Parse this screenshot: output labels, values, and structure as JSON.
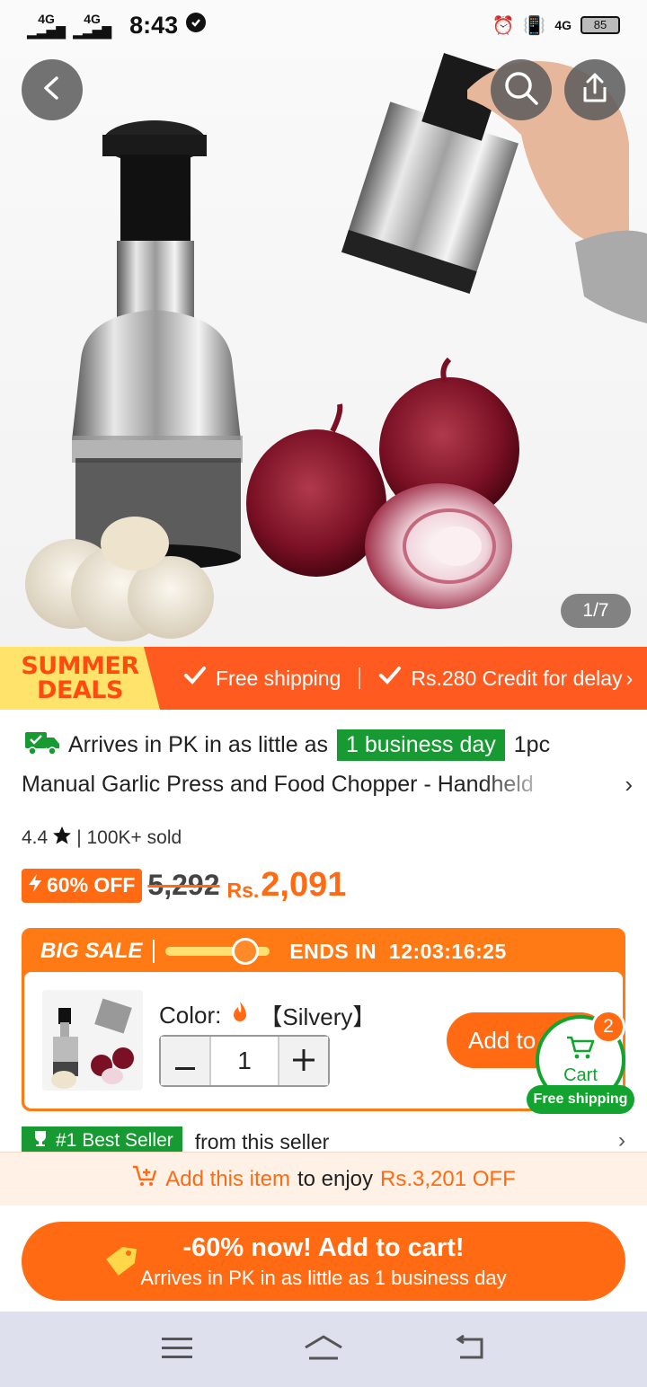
{
  "status_bar": {
    "net1": "4G",
    "net2": "4G",
    "time": "8:43",
    "net3": "4G",
    "battery": "85"
  },
  "hero": {
    "image_counter": "1/7",
    "back_icon": "chevron-left-icon",
    "search_icon": "search-icon",
    "share_icon": "share-icon"
  },
  "deals_banner": {
    "line1": "SUMMER",
    "line2": "DEALS",
    "item1": "Free shipping",
    "item2": "Rs.280 Credit for delay",
    "colors": {
      "banner": "#ff5a1f",
      "badge": "#ffe36b"
    }
  },
  "product": {
    "arrival_prefix": "Arrives in PK in as little as",
    "arrival_highlight": "1 business day",
    "arrival_suffix": "1pc",
    "title": "Manual Garlic Press and Food Chopper - Handheld",
    "rating": "4.4",
    "sold": "| 100K+ sold",
    "discount": "60% OFF",
    "old_price": "5,292",
    "currency": "Rs.",
    "new_price": "2,091"
  },
  "sale": {
    "label": "BIG SALE",
    "ends_label": "ENDS IN",
    "countdown": "12:03:16:25",
    "progress_fraction": 0.8,
    "color_label": "Color:",
    "color_value": "【Silvery】",
    "quantity": "1",
    "add_button": "Add to"
  },
  "cart": {
    "label": "Cart",
    "count": "2",
    "free_shipping": "Free shipping"
  },
  "best_seller": {
    "badge": "#1 Best Seller",
    "text": "from this seller"
  },
  "promo": {
    "highlight": "Add this item",
    "middle": "to enjoy",
    "amount": "Rs.3,201 OFF"
  },
  "cta": {
    "main": "-60% now! Add to cart!",
    "sub": "Arrives in PK in as little as 1 business day"
  },
  "navbar": {
    "menu_icon": "menu-icon",
    "home_icon": "home-icon",
    "back_icon": "back-icon"
  },
  "colors": {
    "accent": "#ff6a13",
    "green": "#179a32",
    "navbar": "#dfe0ee"
  }
}
